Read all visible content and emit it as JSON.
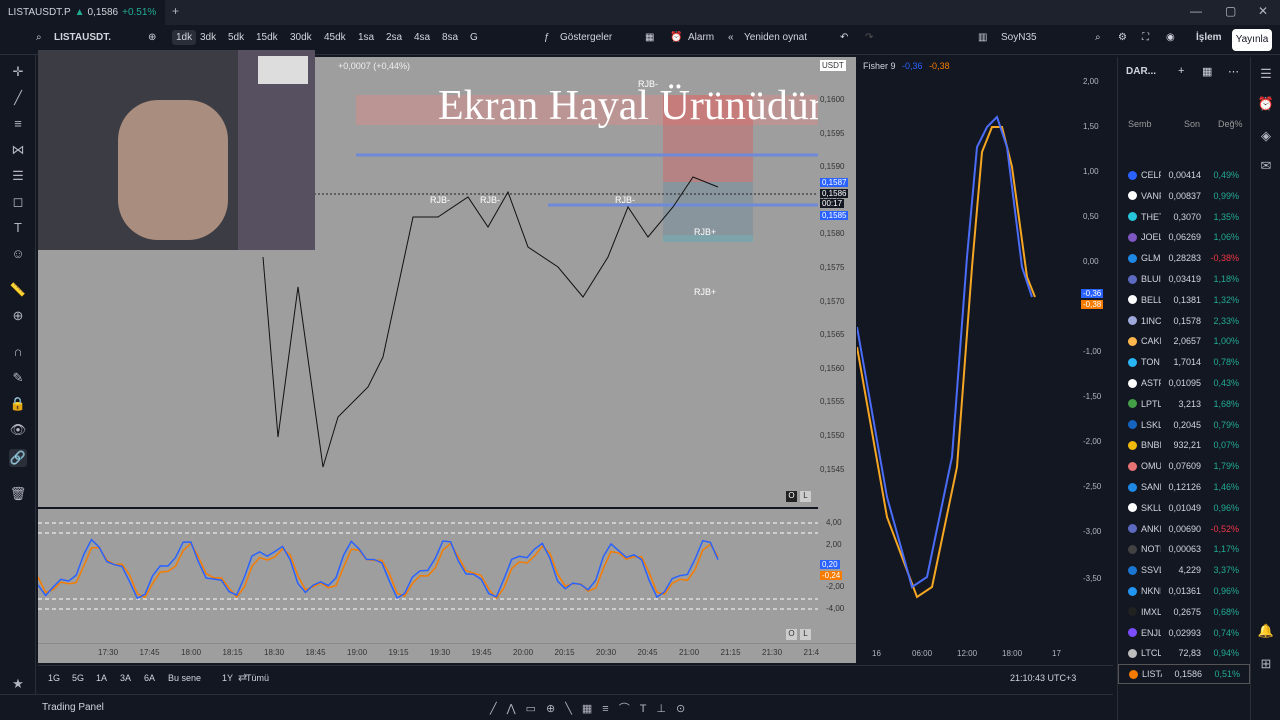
{
  "tab": {
    "title": "LISTAUSDT.P",
    "price": "0,1586",
    "change": "+0.51%"
  },
  "toolbar": {
    "symbol": "LISTAUSDT.",
    "intervals": [
      "1dk",
      "3dk",
      "5dk",
      "15dk",
      "30dk",
      "45dk",
      "1sa",
      "2sa",
      "4sa",
      "8sa",
      "G"
    ],
    "active_interval": "1dk",
    "indicators": "Göstergeler",
    "alarm": "Alarm",
    "replay": "Yeniden oynat",
    "layout": "SoyN35",
    "trade": "İşlem",
    "publish": "Yayınla"
  },
  "chart": {
    "currency": "USDT",
    "change": "+0,0007 (+0,44%)",
    "overlay": "Ekran Hayal Ürünüdür",
    "price_ticks": [
      "0,1600",
      "0,1595",
      "0,1590",
      "0,1585",
      "0,1580",
      "0,1575",
      "0,1570",
      "0,1565",
      "0,1560",
      "0,1555",
      "0,1550",
      "0,1545"
    ],
    "price_tag_high": "0,1587",
    "price_tag_last": "0,1586",
    "countdown": "00:17",
    "price_tag_low": "0,1585",
    "rjb_labels": [
      "RJB-",
      "RJB-",
      "RJB-",
      "RJB-",
      "RJB+",
      "RJB+"
    ],
    "scale_buttons": [
      "O",
      "L"
    ]
  },
  "oscillator": {
    "ticks": [
      "4,00",
      "2,00",
      "-2,00",
      "-4,00"
    ],
    "tag1": "0,20",
    "tag2": "-0,24"
  },
  "time_axis": [
    "17:30",
    "17:45",
    "18:00",
    "18:15",
    "18:30",
    "18:45",
    "19:00",
    "19:15",
    "19:30",
    "19:45",
    "20:00",
    "20:15",
    "20:30",
    "20:45",
    "21:00",
    "21:15",
    "21:30",
    "21:4"
  ],
  "fisher": {
    "title": "Fisher 9",
    "v1": "-0,36",
    "v2": "-0,38",
    "ticks": [
      "2,00",
      "1,50",
      "1,00",
      "0,50",
      "0,00",
      "-1,00",
      "-1,50",
      "-2,00",
      "-2,50",
      "-3,00",
      "-3,50"
    ],
    "time_axis": [
      "16",
      "06:00",
      "12:00",
      "18:00",
      "17"
    ]
  },
  "bottom": {
    "ranges": [
      "1G",
      "5G",
      "1A",
      "3A",
      "6A",
      "Bu sene",
      "1Y",
      "Tümü"
    ],
    "clock": "21:10:43 UTC+3",
    "panel": "Trading Panel"
  },
  "watchlist": {
    "title": "DAR...",
    "headers": [
      "Semb",
      "Son",
      "Değ%"
    ],
    "rows": [
      {
        "sym": "CELF",
        "last": "0,00414",
        "chg": "0,49%",
        "dir": "pos",
        "color": "#2962ff"
      },
      {
        "sym": "VANF",
        "last": "0,00837",
        "chg": "0,99%",
        "dir": "pos",
        "color": "#ffffff"
      },
      {
        "sym": "THET",
        "last": "0,3070",
        "chg": "1,35%",
        "dir": "pos",
        "color": "#26c6da"
      },
      {
        "sym": "JOEL",
        "last": "0,06269",
        "chg": "1,06%",
        "dir": "pos",
        "color": "#7e57c2"
      },
      {
        "sym": "GLM",
        "last": "0,28283",
        "chg": "-0,38%",
        "dir": "neg",
        "color": "#1e88e5"
      },
      {
        "sym": "BLUI",
        "last": "0,03419",
        "chg": "1,18%",
        "dir": "pos",
        "color": "#5c6bc0"
      },
      {
        "sym": "BELL",
        "last": "0,1381",
        "chg": "1,32%",
        "dir": "pos",
        "color": "#ffffff"
      },
      {
        "sym": "1INC",
        "last": "0,1578",
        "chg": "2,33%",
        "dir": "pos",
        "color": "#9fa8da"
      },
      {
        "sym": "CAKI",
        "last": "2,0657",
        "chg": "1,00%",
        "dir": "pos",
        "color": "#ffb74d"
      },
      {
        "sym": "TON",
        "last": "1,7014",
        "chg": "0,78%",
        "dir": "pos",
        "color": "#29b6f6"
      },
      {
        "sym": "ASTF",
        "last": "0,01095",
        "chg": "0,43%",
        "dir": "pos",
        "color": "#ffffff"
      },
      {
        "sym": "LPTL",
        "last": "3,213",
        "chg": "1,68%",
        "dir": "pos",
        "color": "#43a047"
      },
      {
        "sym": "LSKL",
        "last": "0,2045",
        "chg": "0,79%",
        "dir": "pos",
        "color": "#1565c0"
      },
      {
        "sym": "BNBI",
        "last": "932,21",
        "chg": "0,07%",
        "dir": "pos",
        "color": "#f0b90b"
      },
      {
        "sym": "OMU",
        "last": "0,07609",
        "chg": "1,79%",
        "dir": "pos",
        "color": "#e57373"
      },
      {
        "sym": "SANI",
        "last": "0,12126",
        "chg": "1,46%",
        "dir": "pos",
        "color": "#1e88e5"
      },
      {
        "sym": "SKLL",
        "last": "0,01049",
        "chg": "0,96%",
        "dir": "pos",
        "color": "#ffffff"
      },
      {
        "sym": "ANKI",
        "last": "0,00690",
        "chg": "-0,52%",
        "dir": "neg",
        "color": "#5c6bc0"
      },
      {
        "sym": "NOTI",
        "last": "0,00063",
        "chg": "1,17%",
        "dir": "pos",
        "color": "#424242"
      },
      {
        "sym": "SSVL",
        "last": "4,229",
        "chg": "3,37%",
        "dir": "pos",
        "color": "#1976d2"
      },
      {
        "sym": "NKNI",
        "last": "0,01361",
        "chg": "0,96%",
        "dir": "pos",
        "color": "#2196f3"
      },
      {
        "sym": "IMXL",
        "last": "0,2675",
        "chg": "0,68%",
        "dir": "pos",
        "color": "#212121"
      },
      {
        "sym": "ENJL",
        "last": "0,02993",
        "chg": "0,74%",
        "dir": "pos",
        "color": "#7c4dff"
      },
      {
        "sym": "LTCL",
        "last": "72,83",
        "chg": "0,94%",
        "dir": "pos",
        "color": "#bdbdbd"
      },
      {
        "sym": "LISTA",
        "last": "0,1586",
        "chg": "0,51%",
        "dir": "pos",
        "color": "#f57c00"
      }
    ]
  }
}
